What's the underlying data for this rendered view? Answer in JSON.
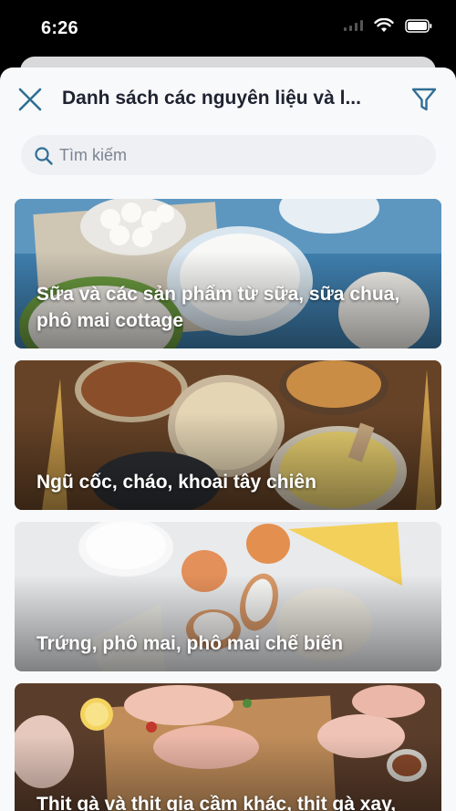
{
  "status_bar": {
    "time": "6:26"
  },
  "header": {
    "title": "Danh sách các nguyên liệu và l..."
  },
  "search": {
    "placeholder": "Tìm kiếm"
  },
  "categories": [
    {
      "title": "Sữa và các sản phẩm từ sữa, sữa chua, phô mai cottage"
    },
    {
      "title": "Ngũ cốc, cháo, khoai tây chiên"
    },
    {
      "title": "Trứng, phô mai, phô mai chế biến"
    },
    {
      "title": "Thịt gà và thịt gia cầm khác, thịt gà xay, phụ phẩm"
    }
  ],
  "colors": {
    "accent": "#2f6e94",
    "title": "#1e2330",
    "sheet": "#f8f9fb"
  }
}
